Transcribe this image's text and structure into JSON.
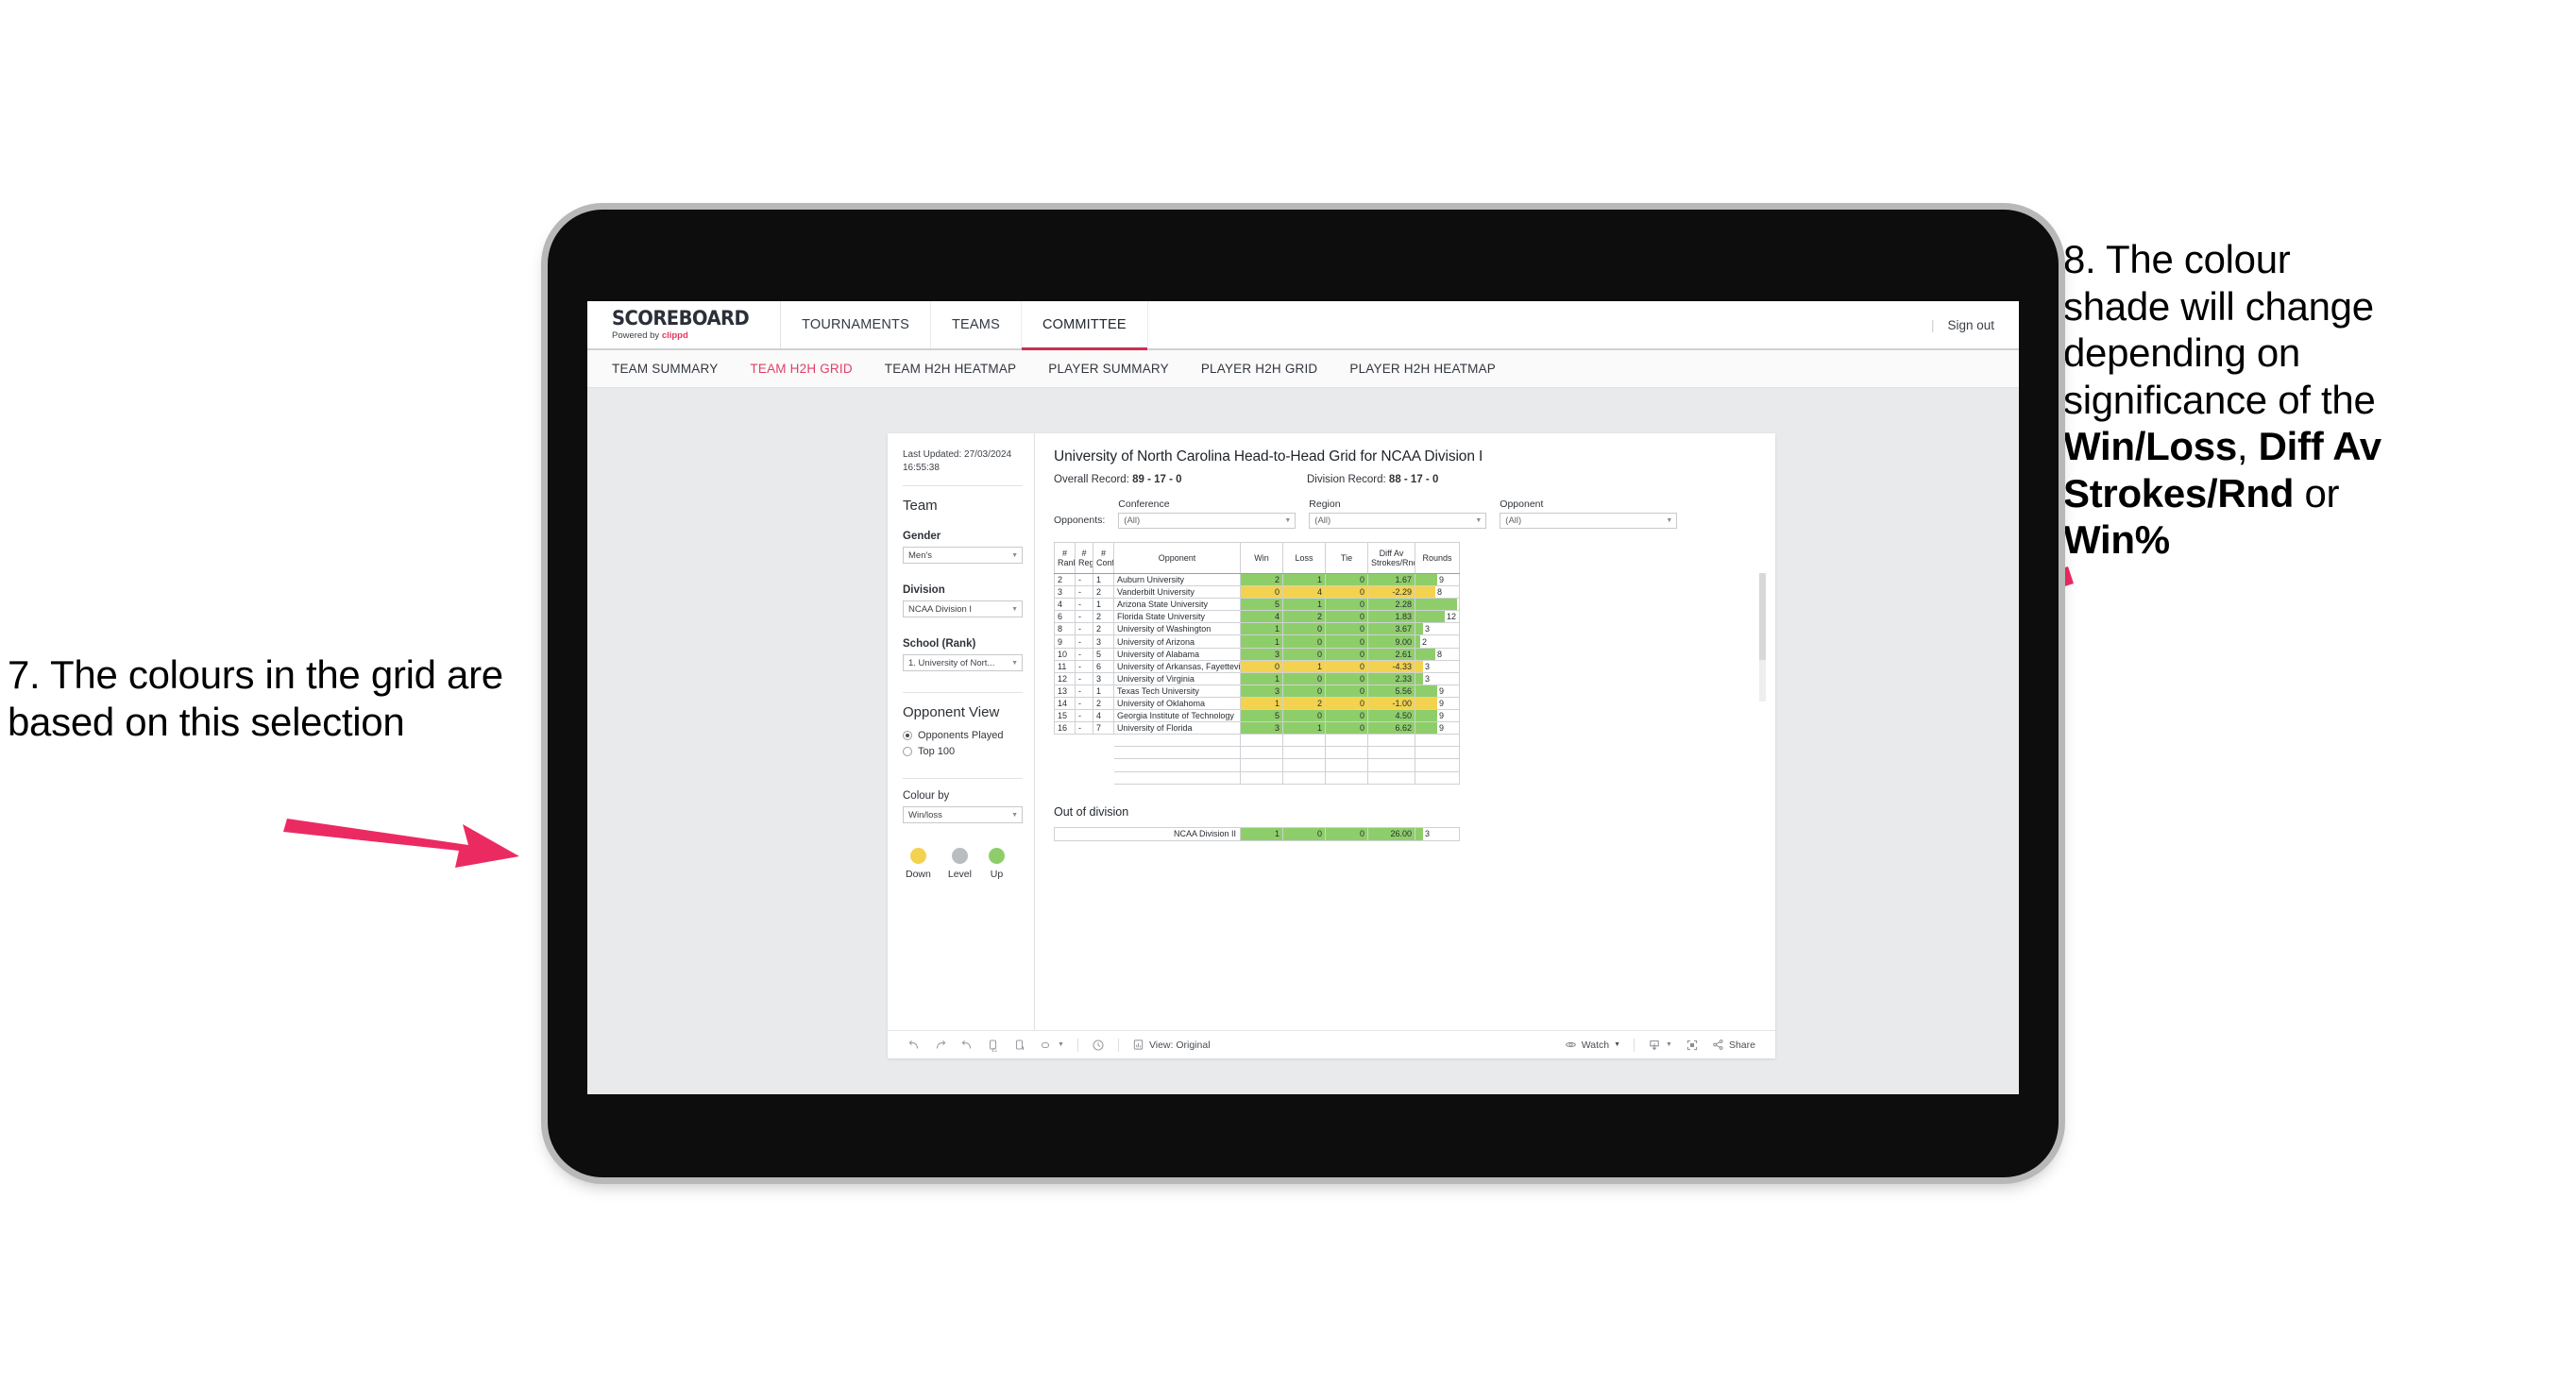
{
  "annotations": {
    "left": {
      "id": "annotation-7",
      "text": "7. The colours in the grid are based on this selection"
    },
    "right": {
      "id": "annotation-8",
      "line1": "8. The colour",
      "line2": "shade will change",
      "line3": "depending on",
      "line4": "significance of the",
      "bold1": "Win/Loss",
      "mid1": ", ",
      "bold2": "Diff Av Strokes/Rnd",
      "mid2": " or",
      "bold3": "Win%"
    },
    "arrow_color": "#ec2a62"
  },
  "app": {
    "brand": {
      "wordmark": "SCOREBOARD",
      "powered_prefix": "Powered by ",
      "powered_brand": "clippd"
    },
    "top_nav": [
      {
        "label": "TOURNAMENTS",
        "active": false
      },
      {
        "label": "TEAMS",
        "active": false
      },
      {
        "label": "COMMITTEE",
        "active": true
      }
    ],
    "sign_out": "Sign out",
    "separator": "|",
    "sub_nav": [
      {
        "label": "TEAM SUMMARY",
        "active": false
      },
      {
        "label": "TEAM H2H GRID",
        "active": true
      },
      {
        "label": "TEAM H2H HEATMAP",
        "active": false
      },
      {
        "label": "PLAYER SUMMARY",
        "active": false
      },
      {
        "label": "PLAYER H2H GRID",
        "active": false
      },
      {
        "label": "PLAYER H2H HEATMAP",
        "active": false
      }
    ],
    "accent_color": "#e23f66"
  },
  "filters": {
    "last_updated": "Last Updated: 27/03/2024 16:55:38",
    "team_heading": "Team",
    "gender": {
      "label": "Gender",
      "value": "Men's"
    },
    "division": {
      "label": "Division",
      "value": "NCAA Division I"
    },
    "school": {
      "label": "School (Rank)",
      "value": "1. University of Nort..."
    },
    "opponent_view": {
      "heading": "Opponent View",
      "options": [
        {
          "label": "Opponents Played",
          "selected": true
        },
        {
          "label": "Top 100",
          "selected": false
        }
      ]
    },
    "colour_by": {
      "label": "Colour by",
      "value": "Win/loss"
    },
    "legend": [
      {
        "label": "Down",
        "color": "#f3d24f"
      },
      {
        "label": "Level",
        "color": "#b9bcc1"
      },
      {
        "label": "Up",
        "color": "#8ece6a"
      }
    ]
  },
  "report": {
    "title": "University of North Carolina Head-to-Head Grid for NCAA Division I",
    "overall_record_label": "Overall Record: ",
    "overall_record_value": "89 - 17 - 0",
    "division_record_label": "Division Record: ",
    "division_record_value": "88 - 17 - 0",
    "opponents_label": "Opponents:",
    "dropdowns": [
      {
        "caption": "Conference",
        "value": "(All)"
      },
      {
        "caption": "Region",
        "value": "(All)"
      },
      {
        "caption": "Opponent",
        "value": "(All)"
      }
    ]
  },
  "chart_data": {
    "type": "table",
    "title": "University of North Carolina Head-to-Head Grid for NCAA Division I",
    "columns": [
      "# Rank",
      "# Reg",
      "# Conf",
      "Opponent",
      "Win",
      "Loss",
      "Tie",
      "Diff Av Strokes/Rnd",
      "Rounds"
    ],
    "column_headers_multiline": [
      {
        "l1": "#",
        "l2": "Rank"
      },
      {
        "l1": "#",
        "l2": "Reg"
      },
      {
        "l1": "#",
        "l2": "Conf"
      },
      {
        "l1": "Opponent",
        "l2": ""
      },
      {
        "l1": "Win",
        "l2": ""
      },
      {
        "l1": "Loss",
        "l2": ""
      },
      {
        "l1": "Tie",
        "l2": ""
      },
      {
        "l1": "Diff Av",
        "l2": "Strokes/Rnd"
      },
      {
        "l1": "Rounds",
        "l2": ""
      }
    ],
    "rounds_max": 17,
    "colour_mode": "Win/loss",
    "rows": [
      {
        "rank": "2",
        "reg": "-",
        "conf": "1",
        "opponent": "Auburn University",
        "win": "2",
        "loss": "1",
        "tie": "0",
        "diff": "1.67",
        "rounds": 9,
        "state": "up"
      },
      {
        "rank": "3",
        "reg": "-",
        "conf": "2",
        "opponent": "Vanderbilt University",
        "win": "0",
        "loss": "4",
        "tie": "0",
        "diff": "-2.29",
        "rounds": 8,
        "state": "down"
      },
      {
        "rank": "4",
        "reg": "-",
        "conf": "1",
        "opponent": "Arizona State University",
        "win": "5",
        "loss": "1",
        "tie": "0",
        "diff": "2.28",
        "rounds": 17,
        "state": "up"
      },
      {
        "rank": "6",
        "reg": "-",
        "conf": "2",
        "opponent": "Florida State University",
        "win": "4",
        "loss": "2",
        "tie": "0",
        "diff": "1.83",
        "rounds": 12,
        "state": "up"
      },
      {
        "rank": "8",
        "reg": "-",
        "conf": "2",
        "opponent": "University of Washington",
        "win": "1",
        "loss": "0",
        "tie": "0",
        "diff": "3.67",
        "rounds": 3,
        "state": "up"
      },
      {
        "rank": "9",
        "reg": "-",
        "conf": "3",
        "opponent": "University of Arizona",
        "win": "1",
        "loss": "0",
        "tie": "0",
        "diff": "9.00",
        "rounds": 2,
        "state": "up"
      },
      {
        "rank": "10",
        "reg": "-",
        "conf": "5",
        "opponent": "University of Alabama",
        "win": "3",
        "loss": "0",
        "tie": "0",
        "diff": "2.61",
        "rounds": 8,
        "state": "up"
      },
      {
        "rank": "11",
        "reg": "-",
        "conf": "6",
        "opponent": "University of Arkansas, Fayetteville",
        "win": "0",
        "loss": "1",
        "tie": "0",
        "diff": "-4.33",
        "rounds": 3,
        "state": "down"
      },
      {
        "rank": "12",
        "reg": "-",
        "conf": "3",
        "opponent": "University of Virginia",
        "win": "1",
        "loss": "0",
        "tie": "0",
        "diff": "2.33",
        "rounds": 3,
        "state": "up"
      },
      {
        "rank": "13",
        "reg": "-",
        "conf": "1",
        "opponent": "Texas Tech University",
        "win": "3",
        "loss": "0",
        "tie": "0",
        "diff": "5.56",
        "rounds": 9,
        "state": "up"
      },
      {
        "rank": "14",
        "reg": "-",
        "conf": "2",
        "opponent": "University of Oklahoma",
        "win": "1",
        "loss": "2",
        "tie": "0",
        "diff": "-1.00",
        "rounds": 9,
        "state": "down"
      },
      {
        "rank": "15",
        "reg": "-",
        "conf": "4",
        "opponent": "Georgia Institute of Technology",
        "win": "5",
        "loss": "0",
        "tie": "0",
        "diff": "4.50",
        "rounds": 9,
        "state": "up"
      },
      {
        "rank": "16",
        "reg": "-",
        "conf": "7",
        "opponent": "University of Florida",
        "win": "3",
        "loss": "1",
        "tie": "0",
        "diff": "6.62",
        "rounds": 9,
        "state": "up"
      }
    ],
    "out_of_division": {
      "title": "Out of division",
      "rows": [
        {
          "opponent": "NCAA Division II",
          "win": "1",
          "loss": "0",
          "tie": "0",
          "diff": "26.00",
          "rounds": 3,
          "state": "up"
        }
      ]
    }
  },
  "toolbar": {
    "undo": "undo-icon",
    "redo": "redo-icon",
    "revert": "revert-icon",
    "refresh": "refresh-data-icon",
    "pause": "pause-auto-update-icon",
    "alerts": "alerts-icon",
    "help": "help-icon",
    "view_label": "View: Original",
    "watch_label": "Watch",
    "share_label": "Share",
    "download": "download-icon",
    "fullscreen": "fullscreen-icon"
  }
}
